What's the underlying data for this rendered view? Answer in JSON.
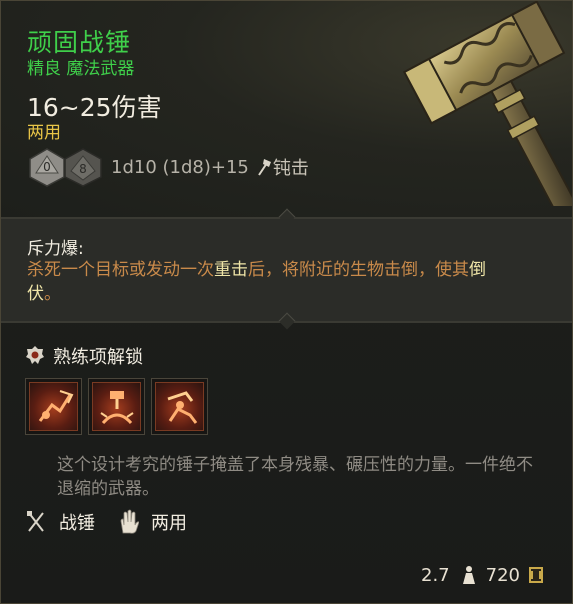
{
  "item": {
    "name": "顽固战锤",
    "rarity_type": "精良 魔法武器",
    "damage": "16~25伤害",
    "handedness": "两用",
    "dice_faces": [
      "0",
      "8"
    ],
    "dice_formula": "1d10 (1d8)+15",
    "damage_type": "钝击"
  },
  "passive": {
    "title": "斥力爆:",
    "text_1": "杀死一个目标或发动一次",
    "hl_1": "重击",
    "text_2": "后，将附近的生物击倒，使其",
    "hl_2": "倒伏",
    "text_3": "。"
  },
  "proficiency": {
    "label": "熟练项解锁",
    "skills": [
      "skill-1",
      "skill-2",
      "skill-3"
    ]
  },
  "flavor": "这个设计考究的锤子掩盖了本身残暴、碾压性的力量。一件绝不退缩的武器。",
  "properties": [
    {
      "icon": "crossed-weapons-icon",
      "label": "战锤"
    },
    {
      "icon": "hand-icon",
      "label": "两用"
    }
  ],
  "footer": {
    "weight": "2.7",
    "value": "720"
  },
  "colors": {
    "name": "#3fcf4a",
    "handedness": "#e8c547",
    "passive_text": "#c98a4a",
    "highlight": "#f0e6a8"
  }
}
